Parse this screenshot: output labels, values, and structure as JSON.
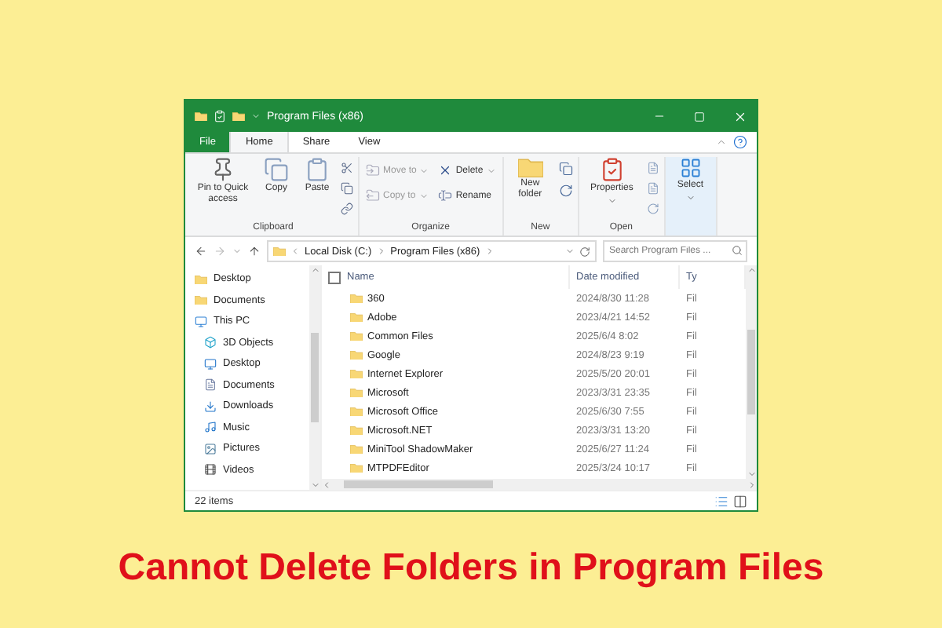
{
  "window": {
    "title": "Program Files (x86)"
  },
  "ribbon_tabs": [
    {
      "label": "File",
      "selected": false,
      "kind": "file"
    },
    {
      "label": "Home",
      "selected": true,
      "kind": "tab"
    },
    {
      "label": "Share",
      "selected": false,
      "kind": "tab"
    },
    {
      "label": "View",
      "selected": false,
      "kind": "tab"
    }
  ],
  "ribbon_groups": [
    {
      "name": "Clipboard",
      "commands": [
        {
          "label": "Pin to Quick access",
          "disabled": false
        },
        {
          "label": "Copy",
          "disabled": false
        },
        {
          "label": "Paste",
          "disabled": false
        }
      ]
    },
    {
      "name": "Organize",
      "commands": [
        {
          "label": "Move to",
          "disabled": true
        },
        {
          "label": "Copy to",
          "disabled": true
        },
        {
          "label": "Delete",
          "disabled": false
        },
        {
          "label": "Rename",
          "disabled": false
        }
      ]
    },
    {
      "name": "New",
      "commands": [
        {
          "label": "New folder",
          "disabled": false
        }
      ]
    },
    {
      "name": "Open",
      "commands": [
        {
          "label": "Properties",
          "disabled": false
        }
      ]
    },
    {
      "commands": [
        {
          "label": "Select",
          "disabled": false
        }
      ]
    }
  ],
  "address": {
    "breadcrumbs": [
      "Local Disk (C:)",
      "Program Files (x86)"
    ],
    "search": {
      "placeholder": "Search Program Files ..."
    }
  },
  "navigation": [
    {
      "label": "Desktop",
      "kind": "folder"
    },
    {
      "label": "Documents",
      "kind": "folder"
    },
    {
      "label": "This PC",
      "kind": "pc",
      "children": [
        {
          "label": "3D Objects",
          "kind": "objects"
        },
        {
          "label": "Desktop",
          "kind": "desktop"
        },
        {
          "label": "Documents",
          "kind": "documents"
        },
        {
          "label": "Downloads",
          "kind": "downloads"
        },
        {
          "label": "Music",
          "kind": "music"
        },
        {
          "label": "Pictures",
          "kind": "pictures"
        },
        {
          "label": "Videos",
          "kind": "videos"
        }
      ]
    }
  ],
  "file_list": {
    "select_all_checked": false,
    "columns": [
      "Name",
      "Date modified",
      "Ty"
    ],
    "rows": [
      {
        "name": "360",
        "date": "2024/8/30 11:28",
        "type": "Fil"
      },
      {
        "name": "Adobe",
        "date": "2023/4/21 14:52",
        "type": "Fil"
      },
      {
        "name": "Common Files",
        "date": "2025/6/4 8:02",
        "type": "Fil"
      },
      {
        "name": "Google",
        "date": "2024/8/23 9:19",
        "type": "Fil"
      },
      {
        "name": "Internet Explorer",
        "date": "2025/5/20 20:01",
        "type": "Fil"
      },
      {
        "name": "Microsoft",
        "date": "2023/3/31 23:35",
        "type": "Fil"
      },
      {
        "name": "Microsoft Office",
        "date": "2025/6/30 7:55",
        "type": "Fil"
      },
      {
        "name": "Microsoft.NET",
        "date": "2023/3/31 13:20",
        "type": "Fil"
      },
      {
        "name": "MiniTool ShadowMaker",
        "date": "2025/6/27 11:24",
        "type": "Fil"
      },
      {
        "name": "MTPDFEditor",
        "date": "2025/3/24 10:17",
        "type": "Fil"
      }
    ]
  },
  "status_bar": {
    "item_count": "22 items"
  },
  "headline": "Cannot Delete Folders in Program Files"
}
